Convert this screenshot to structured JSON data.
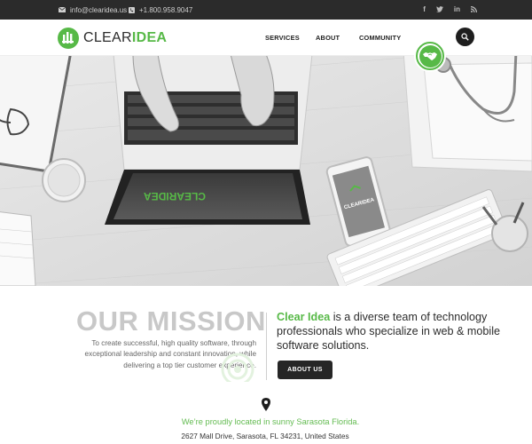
{
  "topbar": {
    "email": "info@clearidea.us",
    "phone": "+1.800.958.9047",
    "social": [
      {
        "icon": "facebook-icon",
        "glyph": "f"
      },
      {
        "icon": "twitter-icon",
        "glyph": "t"
      },
      {
        "icon": "linkedin-icon",
        "glyph": "in"
      },
      {
        "icon": "rss-icon",
        "glyph": "rss"
      }
    ]
  },
  "nav": {
    "logo_clear": "CLEAR",
    "logo_idea": "IDEA",
    "items": [
      "SERVICES",
      "ABOUT",
      "COMMUNITY"
    ]
  },
  "hero": {
    "laptop_logo": "CLEARIDEA",
    "phone_logo": "CLEARIDEA"
  },
  "mission": {
    "title": "OUR MISSION",
    "text": "To create successful, high quality software, through exceptional leadership and constant innovation, while delivering a top tier customer experience.",
    "brand": "Clear Idea",
    "about": " is a diverse team of technology professionals who specialize in web & mobile software solutions.",
    "button": "ABOUT US"
  },
  "location": {
    "line": "We’re proudly located in sunny Sarasota Florida.",
    "address": "2627 Mall Drive, Sarasota, FL 34231, United States"
  },
  "colors": {
    "accent": "#57b947",
    "dark": "#2b2b2b"
  }
}
